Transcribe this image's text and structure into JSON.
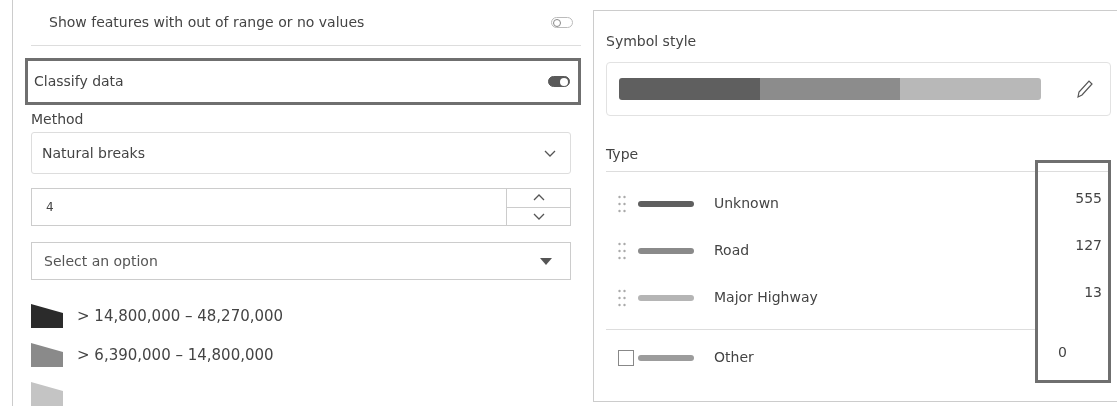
{
  "left_panel": {
    "out_of_range": {
      "label": "Show features with out of range or no values",
      "on": false
    },
    "classify": {
      "label": "Classify data",
      "on": true,
      "highlighted": true
    },
    "method": {
      "label": "Method",
      "value": "Natural breaks"
    },
    "class_count": {
      "value": "4"
    },
    "option_select": {
      "placeholder": "Select an option"
    },
    "classes": [
      {
        "label": "> 14,800,000 – 48,270,000",
        "color": "#2b2b2b"
      },
      {
        "label": "> 6,390,000 – 14,800,000",
        "color": "#8a8a8a"
      },
      {
        "color": "#c4c4c4"
      }
    ]
  },
  "right_panel": {
    "symbol_style": {
      "label": "Symbol style",
      "ramp": [
        {
          "color": "#5f5f5f"
        },
        {
          "color": "#8c8c8c"
        },
        {
          "color": "#b8b8b8"
        }
      ]
    },
    "type": {
      "label": "Type",
      "counts_highlighted": true,
      "items": [
        {
          "kind": "drag",
          "label": "Unknown",
          "count": "555",
          "color": "#5f5f5f"
        },
        {
          "kind": "drag",
          "label": "Road",
          "count": "127",
          "color": "#8a8a8a"
        },
        {
          "kind": "drag",
          "label": "Major Highway",
          "count": "13",
          "color": "#b5b5b5"
        },
        {
          "kind": "checkbox",
          "label": "Other",
          "count": "0",
          "checked": false,
          "color": "#9c9c9c"
        }
      ]
    }
  }
}
